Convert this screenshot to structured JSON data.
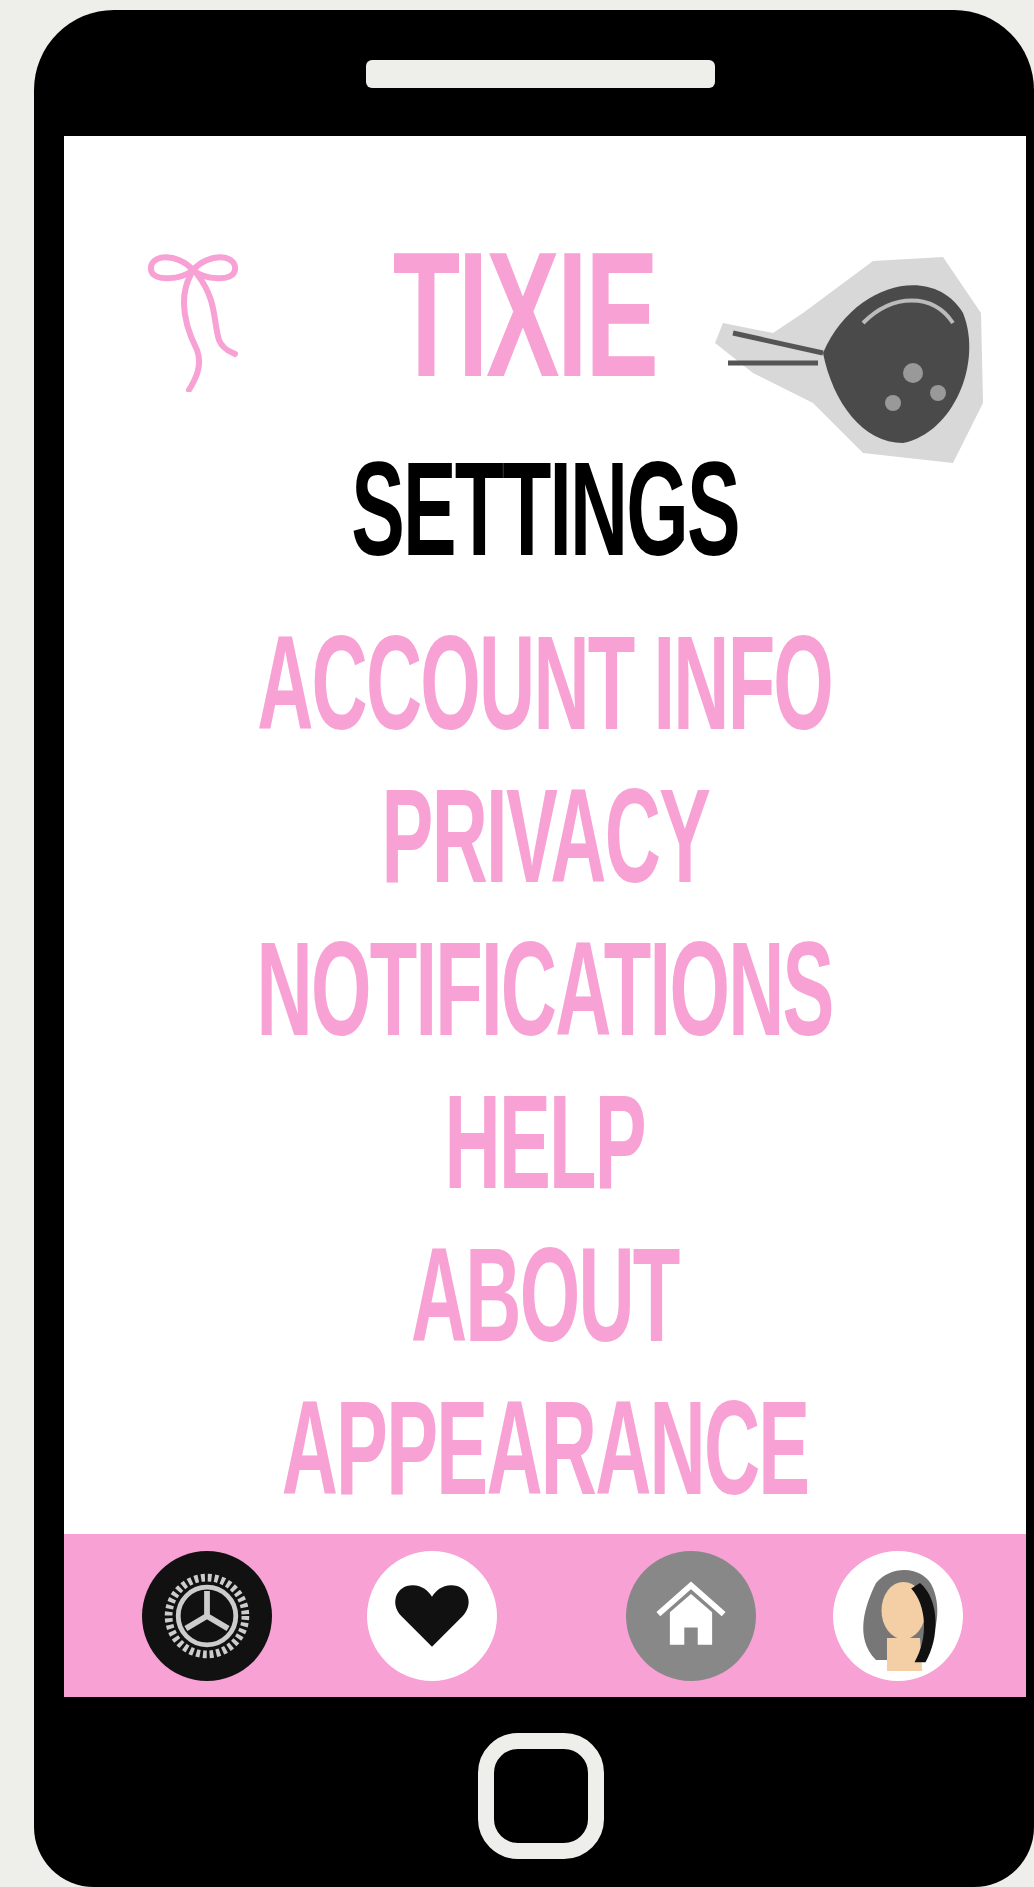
{
  "app": {
    "title": "TIXIE"
  },
  "page": {
    "title": "SETTINGS"
  },
  "menu": [
    {
      "label": "ACCOUNT INFO"
    },
    {
      "label": "PRIVACY"
    },
    {
      "label": "NOTIFICATIONS"
    },
    {
      "label": "HELP"
    },
    {
      "label": "ABOUT"
    },
    {
      "label": "APPEARANCE"
    }
  ],
  "nav": [
    {
      "kind": "settings"
    },
    {
      "kind": "favorites"
    },
    {
      "kind": "home"
    },
    {
      "kind": "profile"
    }
  ]
}
